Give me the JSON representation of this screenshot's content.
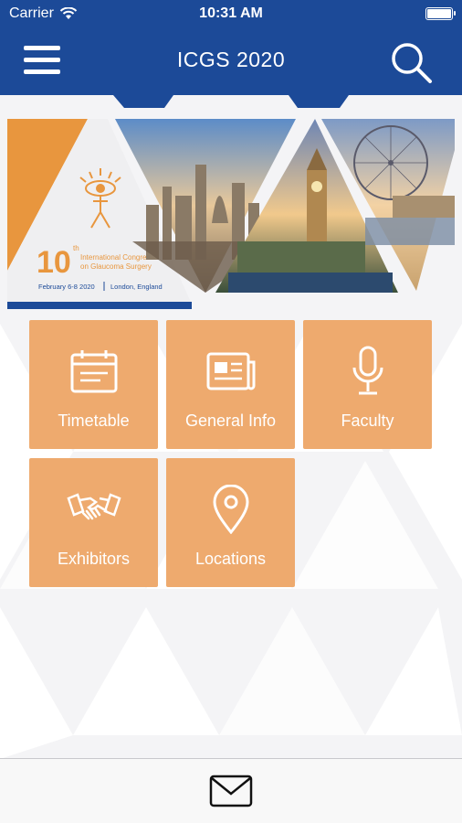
{
  "status_bar": {
    "carrier": "Carrier",
    "time": "10:31 AM",
    "battery_level": 1.0
  },
  "nav": {
    "title": "ICGS 2020",
    "menu_icon": "hamburger-icon",
    "search_icon": "search-icon"
  },
  "banner": {
    "logo_number": "10",
    "logo_superscript": "th",
    "logo_line1": "International Congress",
    "logo_line2": "on Glaucoma Surgery",
    "logo_dates": "February 6-8 2020",
    "logo_location": "London, England"
  },
  "tiles": [
    {
      "label": "Timetable",
      "icon": "calendar-icon"
    },
    {
      "label": "General Info",
      "icon": "newspaper-icon"
    },
    {
      "label": "Faculty",
      "icon": "microphone-icon"
    },
    {
      "label": "Exhibitors",
      "icon": "handshake-icon"
    },
    {
      "label": "Locations",
      "icon": "location-pin-icon"
    }
  ],
  "bottom_bar": {
    "mail_icon": "mail-icon"
  },
  "colors": {
    "nav_blue": "#1c4a98",
    "tile_orange": "#eeaa6e",
    "logo_orange": "#e8963e"
  }
}
